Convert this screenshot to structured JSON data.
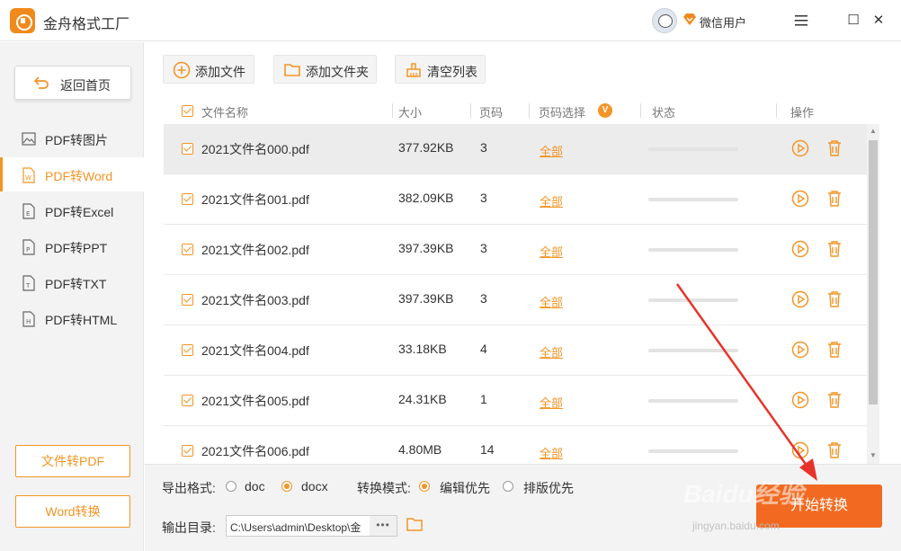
{
  "app": {
    "title": "金舟格式工厂",
    "user": "微信用户",
    "accent": "#f39525"
  },
  "window": {
    "minimize": "—",
    "maximize": "☐",
    "close": "✕"
  },
  "sidebar": {
    "back_label": "返回首页",
    "items": [
      {
        "label": "PDF转图片",
        "icon": "image-file-icon"
      },
      {
        "label": "PDF转Word",
        "icon": "word-file-icon",
        "active": true
      },
      {
        "label": "PDF转Excel",
        "icon": "excel-file-icon"
      },
      {
        "label": "PDF转PPT",
        "icon": "ppt-file-icon"
      },
      {
        "label": "PDF转TXT",
        "icon": "txt-file-icon"
      },
      {
        "label": "PDF转HTML",
        "icon": "html-file-icon"
      }
    ],
    "bottom_buttons": [
      "文件转PDF",
      "Word转换"
    ]
  },
  "toolbar": {
    "add_file": "添加文件",
    "add_folder": "添加文件夹",
    "clear_list": "清空列表"
  },
  "table": {
    "headers": {
      "name": "文件名称",
      "size": "大小",
      "pages": "页码",
      "range": "页码选择",
      "range_badge": "V",
      "status": "状态",
      "actions": "操作"
    },
    "rows": [
      {
        "name": "2021文件名000.pdf",
        "size": "377.92KB",
        "pages": "3",
        "range": "全部",
        "progress": 0,
        "selected": true
      },
      {
        "name": "2021文件名001.pdf",
        "size": "382.09KB",
        "pages": "3",
        "range": "全部",
        "progress": 0
      },
      {
        "name": "2021文件名002.pdf",
        "size": "397.39KB",
        "pages": "3",
        "range": "全部",
        "progress": 0
      },
      {
        "name": "2021文件名003.pdf",
        "size": "397.39KB",
        "pages": "3",
        "range": "全部",
        "progress": 0
      },
      {
        "name": "2021文件名004.pdf",
        "size": "33.18KB",
        "pages": "4",
        "range": "全部",
        "progress": 0
      },
      {
        "name": "2021文件名005.pdf",
        "size": "24.31KB",
        "pages": "1",
        "range": "全部",
        "progress": 0
      },
      {
        "name": "2021文件名006.pdf",
        "size": "4.80MB",
        "pages": "14",
        "range": "全部",
        "progress": 0
      }
    ]
  },
  "bottom": {
    "export_format_label": "导出格式:",
    "formats": [
      {
        "label": "doc",
        "checked": false
      },
      {
        "label": "docx",
        "checked": true
      }
    ],
    "mode_label": "转换模式:",
    "modes": [
      {
        "label": "编辑优先",
        "checked": true
      },
      {
        "label": "排版优先",
        "checked": false
      }
    ],
    "output_dir_label": "输出目录:",
    "output_dir": "C:\\Users\\admin\\Desktop\\金",
    "more": "•••",
    "start": "开始转换"
  },
  "watermark": {
    "main": "Baidu经验",
    "sub": "jingyan.baidu.com"
  }
}
